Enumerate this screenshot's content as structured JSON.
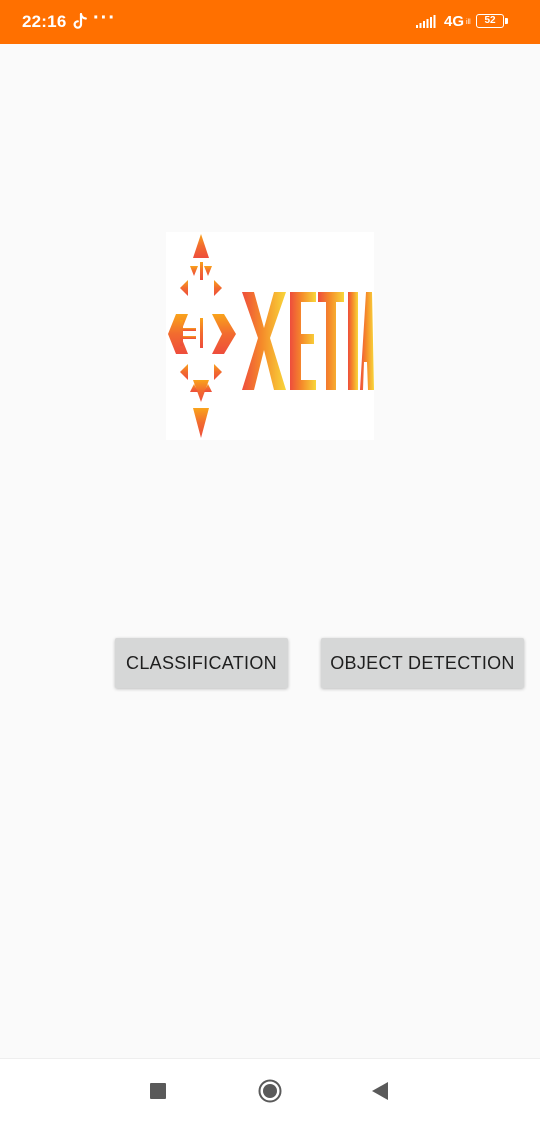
{
  "status_bar": {
    "time": "22:16",
    "more_indicator": "···",
    "network_type": "4G",
    "network_subscript": "ill",
    "battery_level": "52",
    "background_color": "#ff7000",
    "icons": [
      "tiktok-icon",
      "signal-icon",
      "battery-icon"
    ]
  },
  "logo": {
    "text": "XETIA",
    "colors": {
      "orange": "#f9a31b",
      "red": "#ee4d3c",
      "yellow": "#f8d63a"
    }
  },
  "buttons": {
    "classification_label": "CLASSIFICATION",
    "object_detection_label": "OBJECT DETECTION"
  },
  "nav_bar": {
    "icons": [
      "recents-icon",
      "home-icon",
      "back-icon"
    ]
  }
}
